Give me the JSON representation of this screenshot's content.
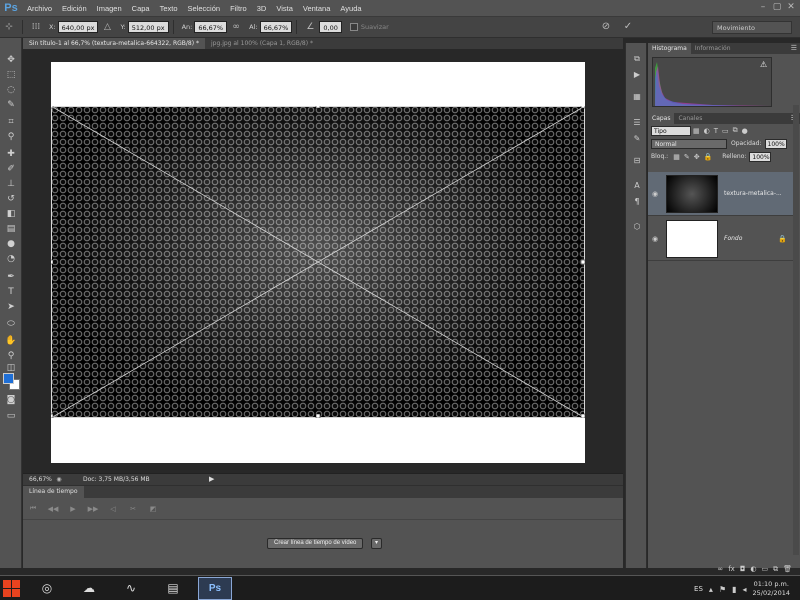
{
  "app": {
    "logo": "Ps"
  },
  "menu": [
    "Archivo",
    "Edición",
    "Imagen",
    "Capa",
    "Texto",
    "Selección",
    "Filtro",
    "3D",
    "Vista",
    "Ventana",
    "Ayuda"
  ],
  "window_controls": {
    "minimize": "–",
    "maximize": "▢",
    "close": "✕"
  },
  "options": {
    "x_label": "X:",
    "x_value": "640,00 px",
    "y_label": "Y:",
    "y_value": "512,00 px",
    "w_label": "An:",
    "w_value": "66,67%",
    "h_label": "Al:",
    "h_value": "66,67%",
    "angle_value": "0,00",
    "smooth_label": "Suavizar",
    "workspace": "Movimiento"
  },
  "doc_tabs": [
    "Sin título-1 al 66,7% (textura-metalica-664322, RGB/8) *",
    "jpg.jpg al 100% (Capa 1, RGB/8) *"
  ],
  "status": {
    "zoom": "66,67%",
    "doc_size": "Doc: 3,75 MB/3,56 MB",
    "arrow": "▶"
  },
  "timeline": {
    "tab": "Línea de tiempo",
    "create_button": "Crear línea de tiempo de vídeo",
    "dropdown": "▾"
  },
  "panels": {
    "top_tabs": [
      "Histograma",
      "Información"
    ],
    "layers_tabs": [
      "Capas",
      "Canales"
    ],
    "filter_kind": "Tipo",
    "blend_mode": "Normal",
    "opacity_label": "Opacidad:",
    "opacity_value": "100%",
    "lock_label": "Bloq.:",
    "fill_label": "Relleno:",
    "fill_value": "100%",
    "layers": [
      {
        "name": "textura-metalica-...",
        "selected": true
      },
      {
        "name": "Fondo",
        "selected": false
      }
    ]
  },
  "taskbar": {
    "ps_label": "Ps",
    "lang": "ES",
    "time": "01:10 p.m.",
    "date": "25/02/2014"
  },
  "colors": {
    "foreground": "#1f6fd6",
    "background": "#ffffff",
    "ps_blue": "#5ba3e0",
    "panel": "#535353",
    "selected_layer": "#616a75"
  }
}
